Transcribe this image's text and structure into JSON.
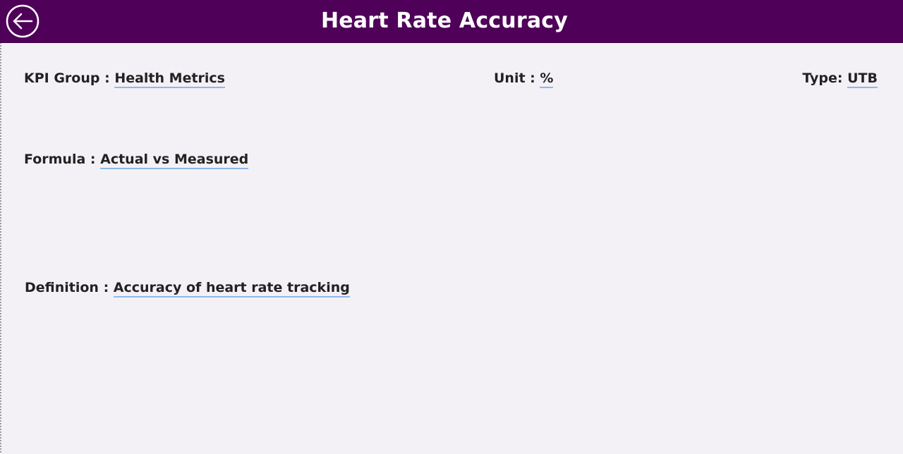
{
  "header": {
    "title": "Heart Rate Accuracy",
    "back_icon": "back-arrow-circle-icon",
    "background_color": "#4f0058"
  },
  "fields": {
    "kpi_group": {
      "label": "KPI Group : ",
      "value": "Health Metrics"
    },
    "unit": {
      "label": "Unit : ",
      "value": "%"
    },
    "type": {
      "label": "Type: ",
      "value": "UTB"
    },
    "formula": {
      "label": "Formula : ",
      "value": "Actual vs Measured"
    },
    "definition": {
      "label": "Definition : ",
      "value": "Accuracy of heart rate tracking"
    }
  },
  "colors": {
    "page_background": "#f4f1f6",
    "value_underline": "#8fb8e6"
  }
}
